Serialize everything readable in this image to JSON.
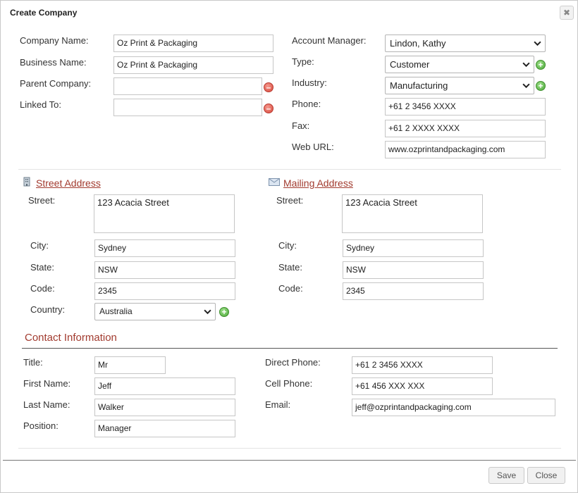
{
  "dialog": {
    "title": "Create Company",
    "close_glyph": "✖"
  },
  "company": {
    "company_name_label": "Company Name:",
    "company_name_value": "Oz Print & Packaging",
    "business_name_label": "Business Name:",
    "business_name_value": "Oz Print & Packaging",
    "parent_company_label": "Parent Company:",
    "parent_company_value": "",
    "linked_to_label": "Linked To:",
    "linked_to_value": "",
    "account_manager_label": "Account Manager:",
    "account_manager_value": "Lindon, Kathy",
    "type_label": "Type:",
    "type_value": "Customer",
    "industry_label": "Industry:",
    "industry_value": "Manufacturing",
    "phone_label": "Phone:",
    "phone_value": "+61 2 3456 XXXX",
    "fax_label": "Fax:",
    "fax_value": "+61 2 XXXX XXXX",
    "web_url_label": "Web URL:",
    "web_url_value": "www.ozprintandpackaging.com"
  },
  "street_address": {
    "heading": "Street Address",
    "icon": "building-icon",
    "street_label": "Street:",
    "street_value": "123 Acacia Street",
    "city_label": "City:",
    "city_value": "Sydney",
    "state_label": "State:",
    "state_value": "NSW",
    "code_label": "Code:",
    "code_value": "2345",
    "country_label": "Country:",
    "country_value": "Australia"
  },
  "mailing_address": {
    "heading": "Mailing Address",
    "icon": "envelope-icon",
    "street_label": "Street:",
    "street_value": "123 Acacia Street",
    "city_label": "City:",
    "city_value": "Sydney",
    "state_label": "State:",
    "state_value": "NSW",
    "code_label": "Code:",
    "code_value": "2345"
  },
  "contact": {
    "heading": "Contact Information",
    "title_label": "Title:",
    "title_value": "Mr",
    "first_name_label": "First Name:",
    "first_name_value": "Jeff",
    "last_name_label": "Last Name:",
    "last_name_value": "Walker",
    "position_label": "Position:",
    "position_value": "Manager",
    "direct_phone_label": "Direct Phone:",
    "direct_phone_value": "+61 2 3456 XXXX",
    "cell_phone_label": "Cell Phone:",
    "cell_phone_value": "+61 456 XXX XXX",
    "email_label": "Email:",
    "email_value": "jeff@ozprintandpackaging.com"
  },
  "footer": {
    "save_label": "Save",
    "close_label": "Close"
  },
  "colors": {
    "accent": "#a23b2f",
    "add": "#4ca838",
    "remove": "#d7463a"
  }
}
